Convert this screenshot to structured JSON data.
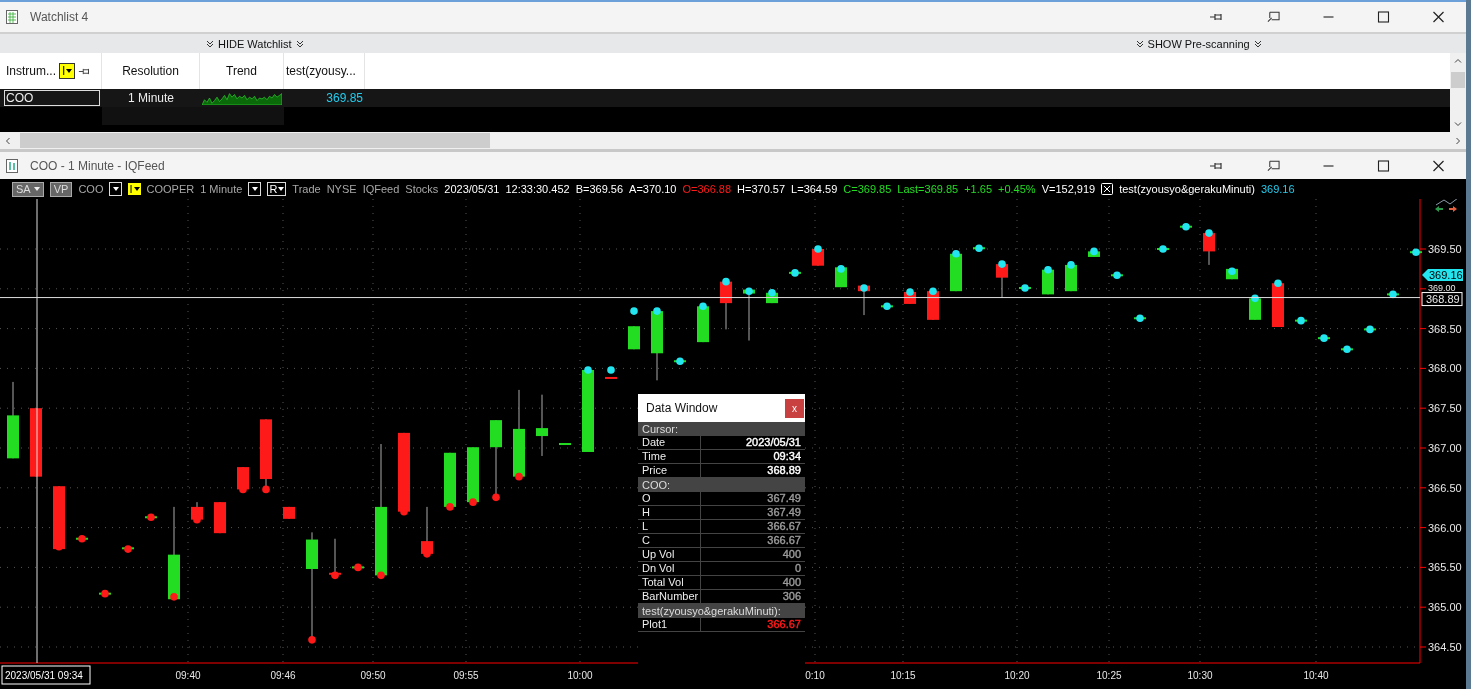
{
  "watchlist_window": {
    "title": "Watchlist 4",
    "toolbar": [
      {
        "label": "HIDE Watchlist"
      },
      {
        "label": "SHOW Pre-scanning"
      }
    ],
    "table": {
      "columns": [
        {
          "label": "Instrum...",
          "button": "I"
        },
        {
          "label": "Resolution"
        },
        {
          "label": "Trend"
        },
        {
          "label": "test(zyousy..."
        }
      ],
      "rows": [
        {
          "instrument": "COO",
          "resolution": "1 Minute",
          "value": "369.85"
        }
      ]
    }
  },
  "chart_window": {
    "title": "COO - 1 Minute - IQFeed",
    "header": [
      {
        "kind": "button",
        "label": "SA",
        "dropdown": true
      },
      {
        "kind": "button",
        "label": "VP",
        "dropdown": false
      },
      {
        "kind": "text",
        "label": "COO",
        "color": "#a8a8a8"
      },
      {
        "kind": "dropdown"
      },
      {
        "kind": "highlight",
        "label": "I"
      },
      {
        "kind": "text",
        "label": "COOPER",
        "color": "#a8a8a8"
      },
      {
        "kind": "text",
        "label": "1 Minute",
        "color": "#a8a8a8"
      },
      {
        "kind": "dropdown"
      },
      {
        "kind": "dropdown",
        "label": "R"
      },
      {
        "kind": "text",
        "label": "Trade",
        "color": "#a8a8a8"
      },
      {
        "kind": "text",
        "label": "NYSE",
        "color": "#a8a8a8"
      },
      {
        "kind": "text",
        "label": "IQFeed",
        "color": "#a8a8a8"
      },
      {
        "kind": "text",
        "label": "Stocks",
        "color": "#a8a8a8"
      },
      {
        "kind": "text",
        "label": "2023/05/31",
        "color": "#ffffff"
      },
      {
        "kind": "text",
        "label": "12:33:30.452",
        "color": "#ffffff"
      },
      {
        "kind": "text",
        "label": "B=369.56",
        "color": "#ffffff"
      },
      {
        "kind": "text",
        "label": "A=370.10",
        "color": "#ffffff"
      },
      {
        "kind": "text",
        "label": "O=366.88",
        "color": "#ff1a1a"
      },
      {
        "kind": "text",
        "label": "H=370.57",
        "color": "#ffffff"
      },
      {
        "kind": "text",
        "label": "L=364.59",
        "color": "#ffffff"
      },
      {
        "kind": "text",
        "label": "C=369.85",
        "color": "#22dd22"
      },
      {
        "kind": "text",
        "label": "Last=369.85",
        "color": "#22dd22"
      },
      {
        "kind": "text",
        "label": "+1.65",
        "color": "#22dd22"
      },
      {
        "kind": "text",
        "label": "+0.45%",
        "color": "#22dd22"
      },
      {
        "kind": "text",
        "label": "V=152,919",
        "color": "#ffffff"
      },
      {
        "kind": "close"
      },
      {
        "kind": "text",
        "label": "test(zyousyo&gerakuMinuti)",
        "color": "#ffffff"
      },
      {
        "kind": "text",
        "label": "369.16",
        "color": "#22ccee"
      }
    ],
    "chart": {
      "y_axis_labels": [
        "369.50",
        "369.00",
        "368.50",
        "368.00",
        "367.50",
        "367.00",
        "366.50",
        "366.00",
        "365.50",
        "365.00",
        "364.50"
      ],
      "x_axis_labels": [
        "09:40",
        "09:46",
        "09:50",
        "09:55",
        "10:00",
        "0:10",
        "10:15",
        "10:20",
        "10:25",
        "10:30",
        "10:40"
      ],
      "cursor_price": "368.89",
      "cursor_time": "2023/05/31 09:34",
      "last_price": "369.16"
    },
    "data_window": {
      "title": "Data Window",
      "close_label": "x",
      "sections": [
        {
          "heading": "Cursor:",
          "rows": [
            {
              "label": "Date",
              "value": "2023/05/31",
              "color": "#ffffff"
            },
            {
              "label": "Time",
              "value": "09:34",
              "color": "#ffffff"
            },
            {
              "label": "Price",
              "value": "368.89",
              "color": "#ffffff"
            }
          ]
        },
        {
          "heading": "COO:",
          "rows": [
            {
              "label": "O",
              "value": "367.49",
              "color": "#9a9a9a"
            },
            {
              "label": "H",
              "value": "367.49",
              "color": "#9a9a9a"
            },
            {
              "label": "L",
              "value": "366.67",
              "color": "#9a9a9a"
            },
            {
              "label": "C",
              "value": "366.67",
              "color": "#9a9a9a"
            },
            {
              "label": "Up Vol",
              "value": "400",
              "color": "#9a9a9a"
            },
            {
              "label": "Dn Vol",
              "value": "0",
              "color": "#9a9a9a"
            },
            {
              "label": "Total Vol",
              "value": "400",
              "color": "#9a9a9a"
            },
            {
              "label": "BarNumber",
              "value": "306",
              "color": "#9a9a9a"
            }
          ]
        },
        {
          "heading": "test(zyousyo&gerakuMinuti):",
          "rows": [
            {
              "label": "Plot1",
              "value": "366.67",
              "color": "#ff1a1a"
            }
          ]
        }
      ]
    }
  }
}
